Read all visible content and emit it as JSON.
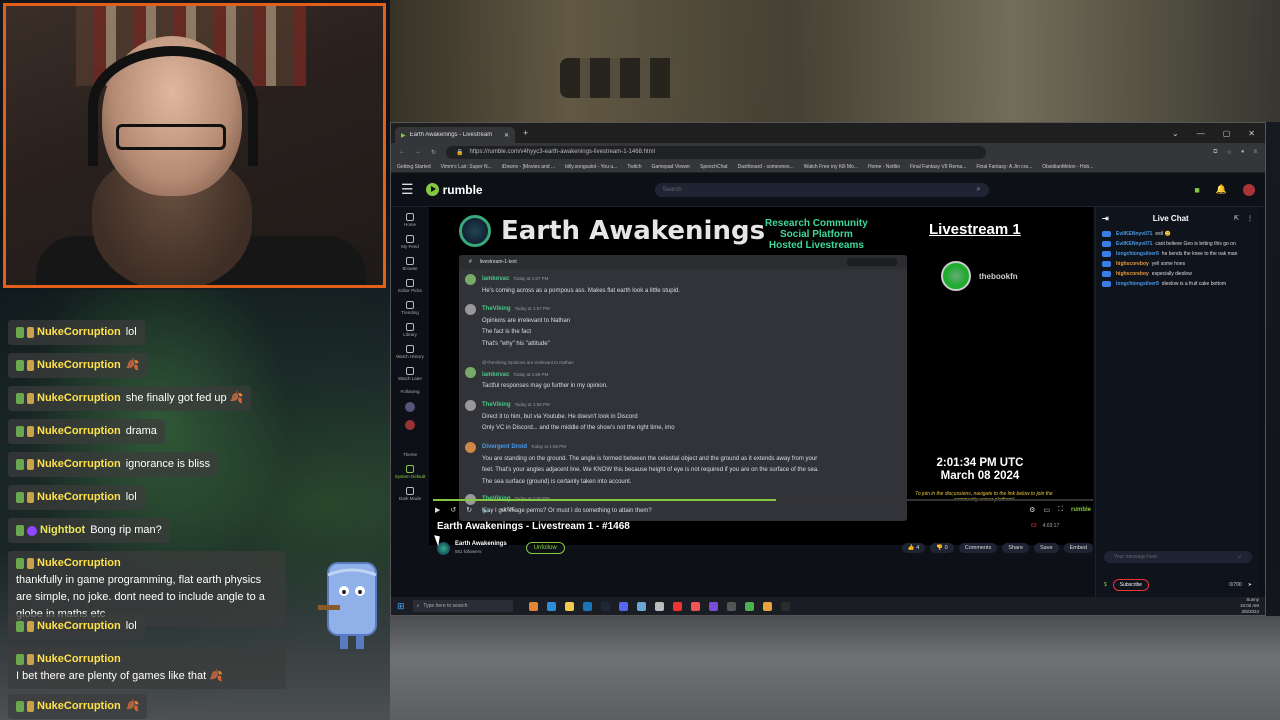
{
  "overlay_chat": {
    "messages": [
      {
        "user": "NukeCorruption",
        "text": "lol"
      },
      {
        "user": "NukeCorruption",
        "text": "🍂"
      },
      {
        "user": "NukeCorruption",
        "text": "she finally got fed up 🍂"
      },
      {
        "user": "NukeCorruption",
        "text": "drama"
      },
      {
        "user": "NukeCorruption",
        "text": "ignorance is bliss"
      },
      {
        "user": "NukeCorruption",
        "text": "lol"
      },
      {
        "user": "Nightbot",
        "text": "Bong rip man?"
      },
      {
        "user": "NukeCorruption",
        "text": "thankfully in game programming, flat earth physics are simple, no joke. dont need to include angle to a globe in maths etc"
      },
      {
        "user": "NukeCorruption",
        "text": "lol"
      },
      {
        "user": "NukeCorruption",
        "text": "I bet there are plenty of games like that 🍂"
      },
      {
        "user": "NukeCorruption",
        "text": "🍂"
      }
    ]
  },
  "browser": {
    "tab_title": "Earth Awakenings - Livestream 1 - #1468",
    "url": "https://rumble.com/v4hyyc3-earth-awakenings-livestream-1-1468.html",
    "bookmarks": [
      "Getting Started",
      "Vimm's Lair: Super N...",
      "iDownv - [Movies and ...",
      "billy.songsalot - You u...",
      "Twitch",
      "Gamepad Viewer",
      "SpeechChat",
      "Dashboard - someones...",
      "Watch Free my Kill Mo...",
      "Home - Nettlio",
      "Final Fantasy VII Rema...",
      "Final Fantasy: A Jin cra...",
      "ObsidianMelon - Hob..."
    ]
  },
  "rumble": {
    "logo_text": "rumble",
    "search_placeholder": "Search",
    "nav": [
      "Home",
      "My Feed",
      "Browse",
      "Editor Picks",
      "Trending",
      "Library",
      "Watch History",
      "Watch Later",
      "Following",
      "Theme",
      "System Default",
      "Dark Mode"
    ],
    "video": {
      "brand_name": "Earth Awakenings",
      "tagline": [
        "Research Community",
        "Social Platform",
        "Hosted Livestreams"
      ],
      "stream_label": "Livestream 1",
      "host_name": "thebookfn",
      "clock": "2:01:34 PM UTC",
      "date": "March 08 2024",
      "join_text": "To join in the discussions, navigate to the link below to join the community server platform!",
      "discord_channel": "livestream-1-text",
      "discord_messages": [
        {
          "user": "iamkovac",
          "time": "Today at 1:57 PM",
          "lines": [
            "He's coming across as a pompous ass. Makes flat earth look a little stupid."
          ],
          "reply": ""
        },
        {
          "user": "TheViking",
          "time": "Today at 1:57 PM",
          "lines": [
            "Opinions are irrelevant to Nathan",
            "The fact is the fact",
            "That's \"why\" his \"attitude\""
          ],
          "reply": ""
        },
        {
          "user": "iamkovac",
          "time": "Today at 1:58 PM",
          "lines": [
            "Tactful responses may go further in my opinion."
          ],
          "reply": "@TheViking Opinions are irrelevant to Nathan"
        },
        {
          "user": "TheViking",
          "time": "Today at 1:58 PM",
          "lines": [
            "Direct it to him, but via Youtube.  He doesn't look in Discord",
            "Only VC in Discord... and the middle of the show's not the right time, imo"
          ],
          "reply": ""
        },
        {
          "user": "Divergent Droid",
          "time": "Today at 1:59 PM",
          "lines": [
            "You are standing on the ground. The angle is formed between the celestial object and the ground as it extends away from your",
            "feet. That's your angles adjacent line.  We KNOW this because height of eye is not required if you are on the surface of the sea.",
            "The sea surface (ground)  is certainly taken into account."
          ],
          "reply": ""
        },
        {
          "user": "TheViking",
          "time": "Today at 2:00 PM",
          "lines": [
            "May I get image perms? Or must I do something to attain them?"
          ],
          "reply": ""
        }
      ],
      "live_label": "• LIVE",
      "progress": 0.52
    },
    "title": "Earth Awakenings - Livestream 1 - #1468",
    "viewers": "63",
    "duration": "4:03:17",
    "channel": {
      "name": "Earth Awakenings",
      "followers": "551 followers",
      "follow_label": "Unfollow"
    },
    "actions": {
      "likes": "4",
      "dislikes": "0",
      "comments": "Comments",
      "share": "Share",
      "save": "Save",
      "embed": "Embed"
    },
    "live_chat": {
      "title": "Live Chat",
      "messages": [
        {
          "user": "EvilKENnyvil71",
          "text": "estl 😊"
        },
        {
          "user": "EvilKENnyvil71",
          "text": "cant believe Geo is letting this go on"
        },
        {
          "user": "longchiongsilver9",
          "text": "he bends the knee to the oak man"
        },
        {
          "user": "highscoreboy",
          "text": "yell some hoes"
        },
        {
          "user": "highscoreboy",
          "text": "especially dieslow"
        },
        {
          "user": "longchiongsilver9",
          "text": "dieslow is a fruit cake bottom"
        }
      ],
      "input_placeholder": "Your message here",
      "subscribe_label": "Subscribe",
      "char_count": "0/700"
    }
  },
  "taskbar": {
    "search_placeholder": "Type here to search",
    "clock_time": "10:02 AM",
    "clock_date": "3/8/2024",
    "weather": "Sunny"
  }
}
